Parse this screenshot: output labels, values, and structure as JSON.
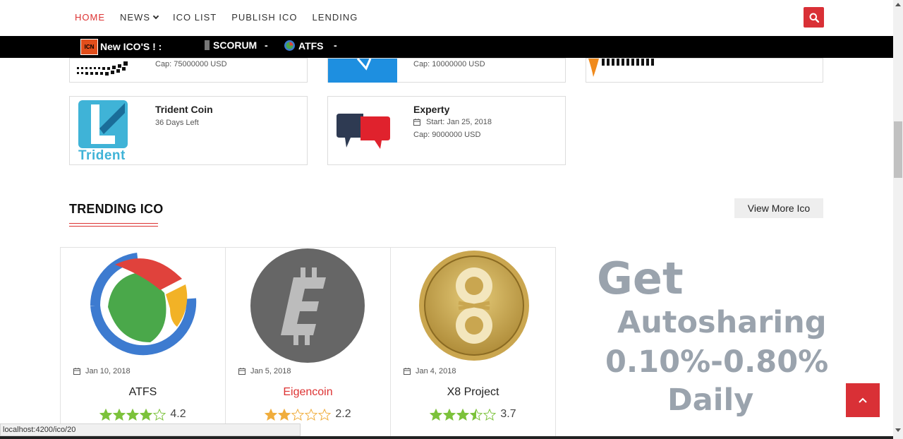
{
  "nav": {
    "items": [
      {
        "label": "HOME",
        "active": true
      },
      {
        "label": "NEWS",
        "dropdown": true
      },
      {
        "label": "ICO LIST"
      },
      {
        "label": "PUBLISH ICO"
      },
      {
        "label": "LENDING"
      }
    ],
    "accent": "#d93036"
  },
  "ticker": {
    "logo_text": "ICN",
    "title": "New ICO'S ! :",
    "items": [
      "SCORUM",
      "ATFS"
    ],
    "separator": "-"
  },
  "upcoming": {
    "row1": [
      {
        "cap": "Cap: 75000000 USD"
      },
      {
        "cap": "Cap: 10000000 USD"
      },
      {}
    ],
    "row2": [
      {
        "name": "Trident Coin",
        "days_left": "36 Days Left",
        "logo_text": "Trident"
      },
      {
        "name": "Experty",
        "start": "Start: Jan 25, 2018",
        "cap": "Cap: 9000000 USD"
      }
    ]
  },
  "trending": {
    "title": "TRENDING ICO",
    "view_more": "View More Ico",
    "items": [
      {
        "date": "Jan 10, 2018",
        "name": "ATFS",
        "rating": 4.2,
        "rating_text": "4.2",
        "highlight": false
      },
      {
        "date": "Jan 5, 2018",
        "name": "Eigencoin",
        "rating": 2.2,
        "rating_text": "2.2",
        "highlight": true
      },
      {
        "date": "Jan 4, 2018",
        "name": "X8 Project",
        "rating": 3.7,
        "rating_text": "3.7",
        "highlight": false
      }
    ]
  },
  "ad": {
    "line1": "Get",
    "line2": "Autosharing",
    "line3": "0.10%-0.80%",
    "line4": "Daily"
  },
  "status_url": "localhost:4200/ico/20",
  "colors": {
    "star_green": "#7cc23b",
    "star_orange": "#f0ad3c",
    "star_empty": "#bbb"
  }
}
